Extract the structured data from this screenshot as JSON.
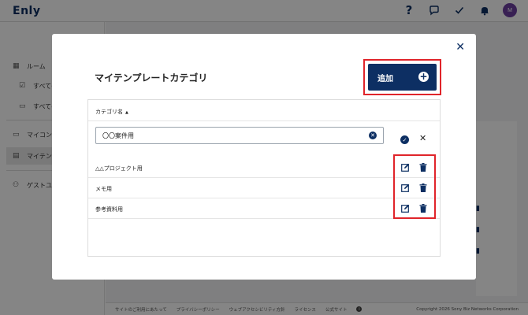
{
  "app": {
    "logo": "Enly",
    "avatar_initial": "M",
    "header_icons": [
      "help-icon",
      "chat-icon",
      "check-icon",
      "bell-icon"
    ]
  },
  "sidebar": {
    "items": [
      {
        "label": "ルーム",
        "icon": "grid-icon"
      },
      {
        "label": "すべての",
        "icon": "checkbox-icon"
      },
      {
        "label": "すべての",
        "icon": "message-icon"
      },
      {
        "label": "マイコンテ",
        "icon": "folder-icon"
      },
      {
        "label": "マイテンプ",
        "icon": "template-icon"
      },
      {
        "label": "ゲストユー",
        "icon": "user-icon"
      }
    ]
  },
  "footer": {
    "links": [
      "サイトのご利用にあたって",
      "プライバシーポリシー",
      "ウェブアクセシビリティ方針",
      "ライセンス",
      "公式サイト"
    ],
    "copyright": "Copyright 2026 Sony Biz Networks Corporation"
  },
  "modal": {
    "title": "マイテンプレートカテゴリ",
    "add_label": "追加",
    "column_header": "カテゴリ名",
    "edit_value": "〇〇案件用",
    "rows": [
      {
        "name": "△△プロジェクト用"
      },
      {
        "name": "メモ用"
      },
      {
        "name": "参考資料用"
      }
    ]
  },
  "colors": {
    "primary": "#0d2f63",
    "highlight": "#e0242a",
    "avatar": "#6b3fa0"
  }
}
